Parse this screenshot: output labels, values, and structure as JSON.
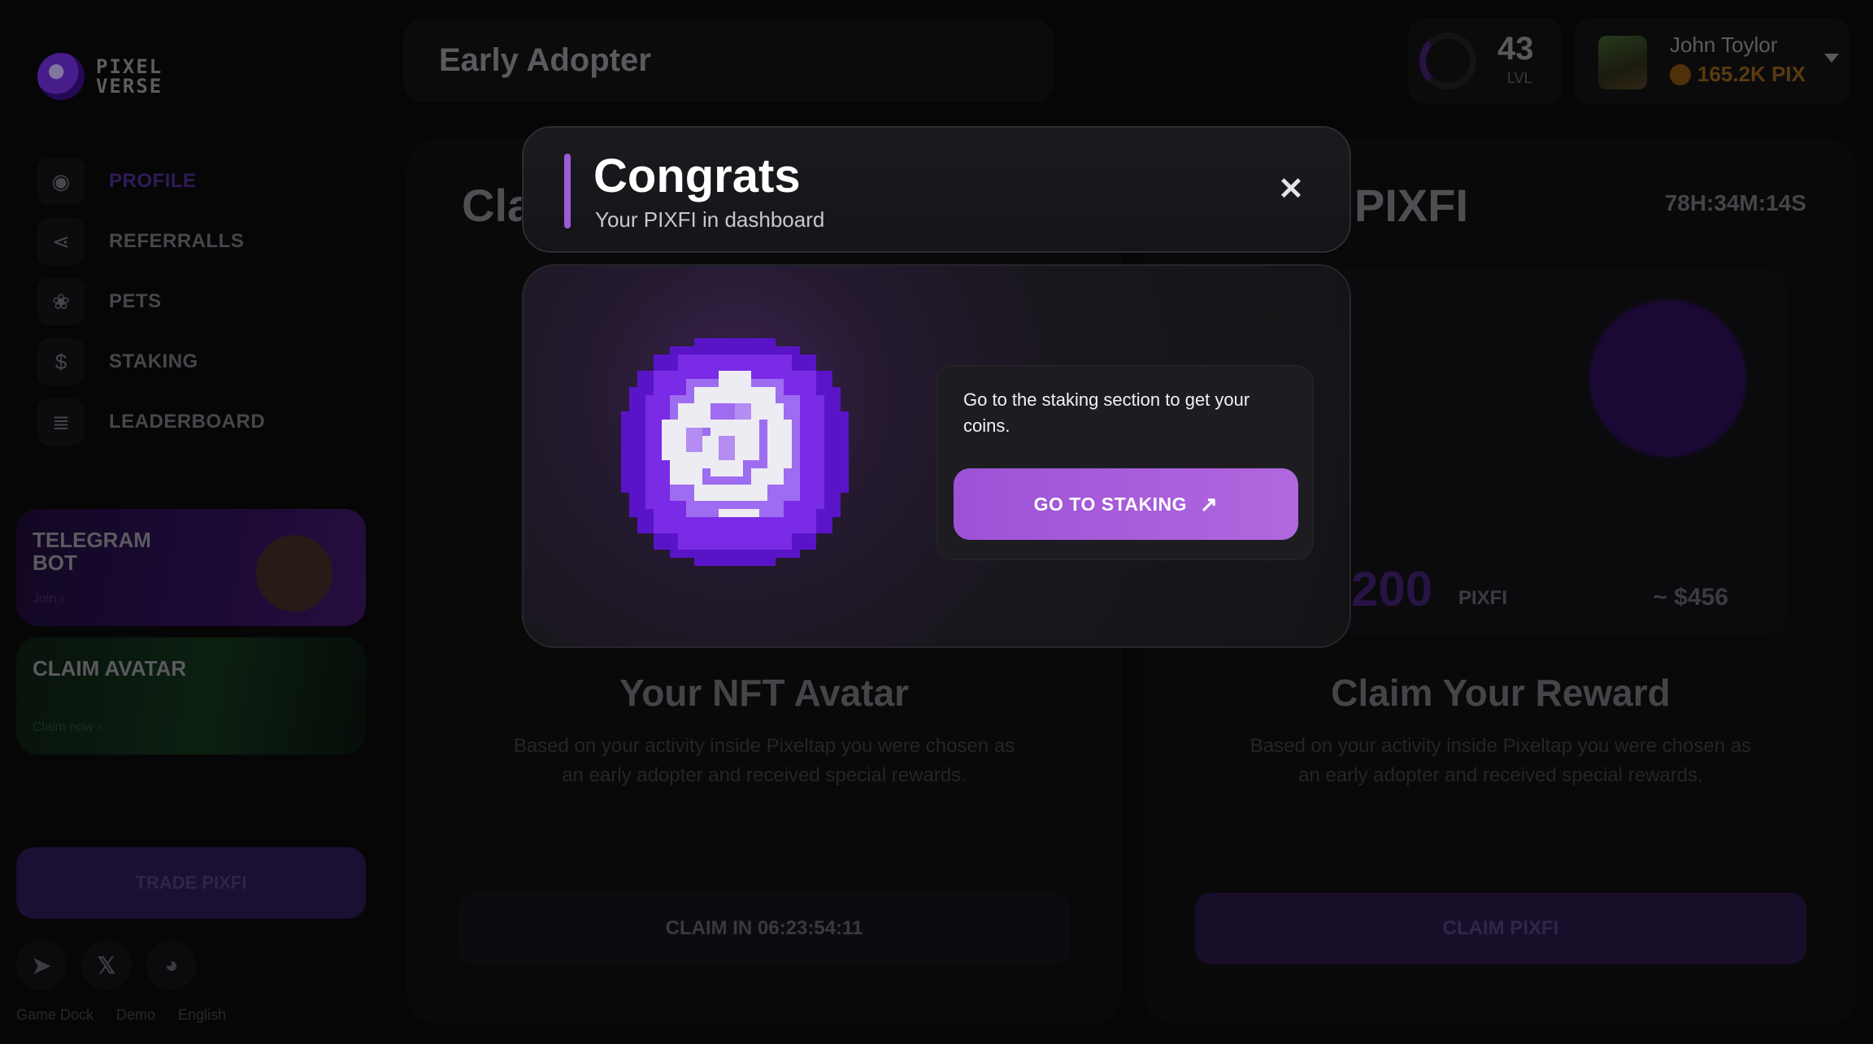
{
  "brand": {
    "logo_line1": "PIXEL",
    "logo_line2": "VERSE"
  },
  "header": {
    "page_title": "Early Adopter"
  },
  "level": {
    "value": "43",
    "label": "LVL"
  },
  "user": {
    "name": "John Toylor",
    "balance": "165.2K PIX"
  },
  "sidebar": {
    "items": [
      {
        "label": "PROFILE",
        "icon": "user-circle-icon"
      },
      {
        "label": "REFERRALLS",
        "icon": "share-icon"
      },
      {
        "label": "PETS",
        "icon": "paw-icon"
      },
      {
        "label": "STAKING",
        "icon": "dollar-coin-icon"
      },
      {
        "label": "LEADERBOARD",
        "icon": "bars-icon"
      }
    ],
    "promo_telegram": {
      "title": "TELEGRAM BOT",
      "cta": "Join  ›"
    },
    "promo_avatar": {
      "title": "CLAIM AVATAR",
      "cta": "Claim now  ›"
    },
    "trade_button": "TRADE PIXFI",
    "footer_links": [
      "Game Dock",
      "Demo",
      "English"
    ]
  },
  "cards": {
    "left": {
      "head": "Cla",
      "title": "Your NFT Avatar",
      "description": "Based on your activity inside Pixeltap you were chosen as an early adopter and received special rewards.",
      "button": "CLAIM IN 06:23:54:11"
    },
    "right": {
      "head": "PIXFI",
      "timer": "78H:34M:14S",
      "amount": "200",
      "unit": "PIXFI",
      "usd": "~ $456",
      "title": "Claim Your Reward",
      "description": "Based on your activity inside Pixeltap you were chosen as an early adopter and received special rewards.",
      "button": "CLAIM PIXFI"
    }
  },
  "modal": {
    "title": "Congrats",
    "subtitle": "Your PIXFI in dashboard",
    "close_icon": "close-icon",
    "info_text": "Go to the staking section to get your coins.",
    "button_label": "GO TO STAKING",
    "button_icon": "arrow-up-right-icon",
    "accent_color": "#a45ad9"
  }
}
